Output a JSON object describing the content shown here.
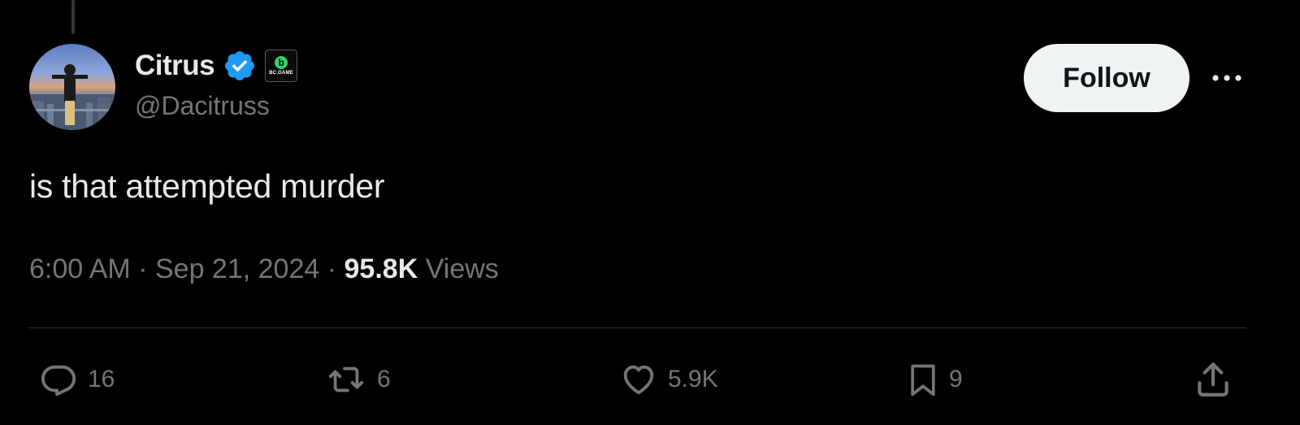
{
  "author": {
    "display_name": "Citrus",
    "handle": "@Dacitruss",
    "verified": true,
    "verified_color": "#1d9bf0",
    "affiliate_badge": {
      "logo_glyph": "b",
      "label": "BC.GAME"
    },
    "avatar_icon": "avatar-photo"
  },
  "follow_button": {
    "label": "Follow"
  },
  "more_icon": "more-horizontal-icon",
  "tweet": {
    "text": "is that attempted murder",
    "time": "6:00 AM",
    "separator": "·",
    "date": "Sep 21, 2024",
    "views_count": "95.8K",
    "views_label": "Views"
  },
  "actions": {
    "reply": {
      "icon": "reply-icon",
      "count": "16"
    },
    "repost": {
      "icon": "repost-icon",
      "count": "6"
    },
    "like": {
      "icon": "heart-icon",
      "count": "5.9K"
    },
    "bookmark": {
      "icon": "bookmark-icon",
      "count": "9"
    },
    "share": {
      "icon": "share-icon"
    }
  },
  "colors": {
    "background": "#000000",
    "text_primary": "#e7e9ea",
    "text_secondary": "#71767b",
    "divider": "#2f3336",
    "follow_bg": "#eff3f4"
  }
}
